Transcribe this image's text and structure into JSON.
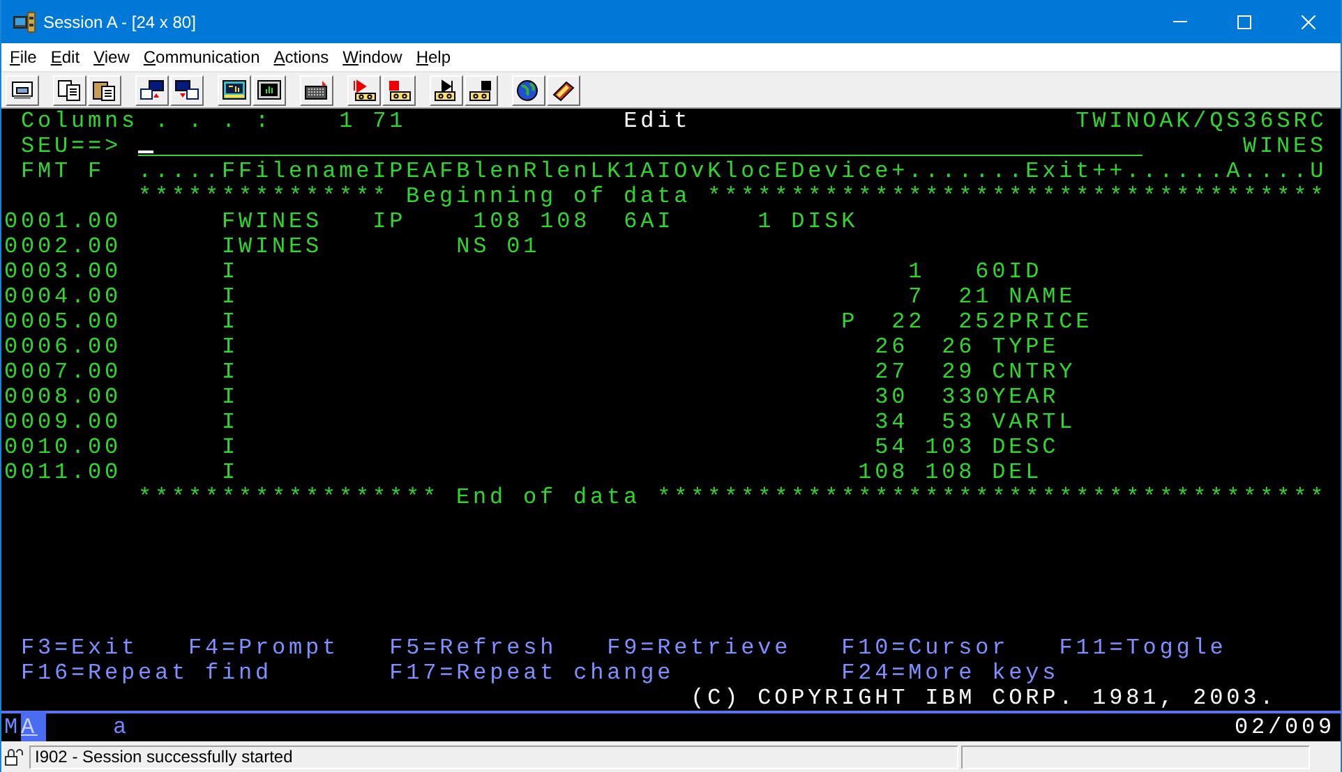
{
  "window": {
    "title": "Session A - [24 x 80]"
  },
  "menu": [
    {
      "label": "File"
    },
    {
      "label": "Edit"
    },
    {
      "label": "View"
    },
    {
      "label": "Communication"
    },
    {
      "label": "Actions"
    },
    {
      "label": "Window"
    },
    {
      "label": "Help"
    }
  ],
  "screen": {
    "lines": [
      {
        "segments": [
          {
            "kind": "text",
            "text": " Columns . . . :    1 71"
          },
          {
            "kind": "title",
            "text": "             Edit"
          },
          {
            "kind": "text",
            "text": "                       TWINOAK/QS36SRC"
          }
        ]
      },
      {
        "segments": [
          {
            "kind": "text",
            "text": " SEU==>"
          },
          {
            "kind": "input"
          },
          {
            "kind": "text",
            "text": "      WINES"
          }
        ]
      },
      {
        "segments": [
          {
            "kind": "text",
            "text": " FMT F  .....FFilenameIPEAFBlenRlenLK1AIOvKlocEDevice+.......Exit++......A....U"
          }
        ]
      },
      {
        "segments": [
          {
            "kind": "text",
            "text": "        *************** Beginning of data *************************************"
          }
        ]
      },
      {
        "segments": [
          {
            "kind": "seq",
            "text": "0001.00"
          },
          {
            "kind": "text",
            "text": "      FWINES   IP    108 108  6AI     1 DISK"
          }
        ]
      },
      {
        "segments": [
          {
            "kind": "seq",
            "text": "0002.00"
          },
          {
            "kind": "text",
            "text": "      IWINES        NS 01"
          }
        ]
      },
      {
        "segments": [
          {
            "kind": "seq",
            "text": "0003.00"
          },
          {
            "kind": "text",
            "text": "      I                                        1   60ID"
          }
        ]
      },
      {
        "segments": [
          {
            "kind": "seq",
            "text": "0004.00"
          },
          {
            "kind": "text",
            "text": "      I                                        7  21 NAME"
          }
        ]
      },
      {
        "segments": [
          {
            "kind": "seq",
            "text": "0005.00"
          },
          {
            "kind": "text",
            "text": "      I                                    P  22  252PRICE"
          }
        ]
      },
      {
        "segments": [
          {
            "kind": "seq",
            "text": "0006.00"
          },
          {
            "kind": "text",
            "text": "      I                                      26  26 TYPE"
          }
        ]
      },
      {
        "segments": [
          {
            "kind": "seq",
            "text": "0007.00"
          },
          {
            "kind": "text",
            "text": "      I                                      27  29 CNTRY"
          }
        ]
      },
      {
        "segments": [
          {
            "kind": "seq",
            "text": "0008.00"
          },
          {
            "kind": "text",
            "text": "      I                                      30  330YEAR"
          }
        ]
      },
      {
        "segments": [
          {
            "kind": "seq",
            "text": "0009.00"
          },
          {
            "kind": "text",
            "text": "      I                                      34  53 VARTL"
          }
        ]
      },
      {
        "segments": [
          {
            "kind": "seq",
            "text": "0010.00"
          },
          {
            "kind": "text",
            "text": "      I                                      54 103 DESC"
          }
        ]
      },
      {
        "segments": [
          {
            "kind": "seq",
            "text": "0011.00"
          },
          {
            "kind": "text",
            "text": "      I                                     108 108 DEL"
          }
        ]
      },
      {
        "segments": [
          {
            "kind": "text",
            "text": "        ****************** End of data ****************************************"
          }
        ]
      }
    ],
    "footer_lines": [
      {
        "segments": [
          {
            "kind": "fkey",
            "text": " F3=Exit   F4=Prompt   F5=Refresh   F9=Retrieve   F10=Cursor   F11=Toggle"
          }
        ]
      },
      {
        "segments": [
          {
            "kind": "fkey",
            "text": " F16=Repeat find       F17=Repeat change          F24=More keys"
          }
        ]
      },
      {
        "segments": [
          {
            "kind": "notice",
            "text": "                                         (C) COPYRIGHT IBM CORP. 1981, 2003."
          }
        ]
      }
    ]
  },
  "oia": {
    "segments": [
      {
        "text": "M",
        "highlighted": false
      },
      {
        "text": "A",
        "highlighted": true
      },
      {
        "text": "    a",
        "highlighted": false
      }
    ],
    "position": "02/009"
  },
  "status_bar": {
    "message": "I902 - Session successfully started"
  }
}
